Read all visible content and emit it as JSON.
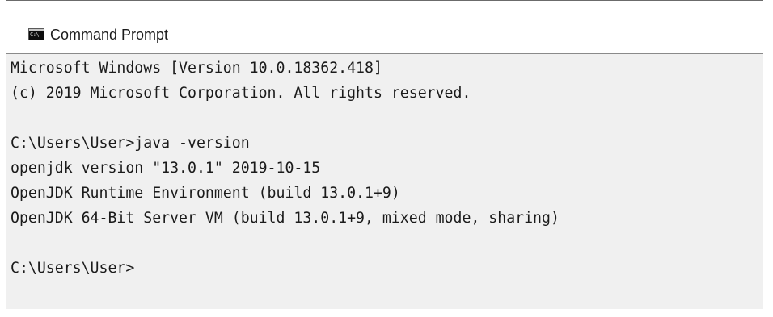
{
  "window": {
    "title": "Command Prompt",
    "icon_label": "C:\\",
    "icon": "console-icon"
  },
  "console": {
    "lines": [
      "Microsoft Windows [Version 10.0.18362.418]",
      "(c) 2019 Microsoft Corporation. All rights reserved.",
      "",
      "C:\\Users\\User>java -version",
      "openjdk version \"13.0.1\" 2019-10-15",
      "OpenJDK Runtime Environment (build 13.0.1+9)",
      "OpenJDK 64-Bit Server VM (build 13.0.1+9, mixed mode, sharing)",
      "",
      "C:\\Users\\User>"
    ]
  },
  "colors": {
    "console_background": "#f0f0f0",
    "text": "#1b1b1b",
    "titlebar": "#ffffff"
  }
}
